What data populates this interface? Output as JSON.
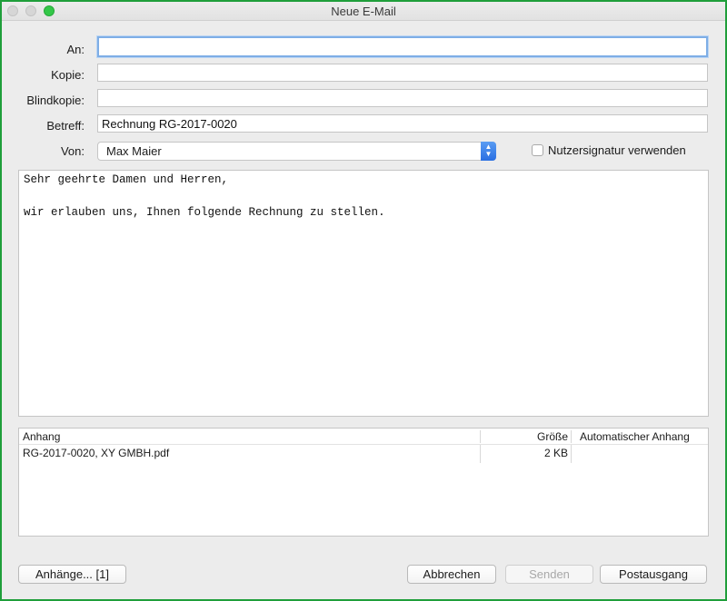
{
  "window": {
    "title": "Neue E-Mail"
  },
  "form": {
    "to_label": "An:",
    "to_value": "",
    "cc_label": "Kopie:",
    "cc_value": "",
    "bcc_label": "Blindkopie:",
    "bcc_value": "",
    "subject_label": "Betreff:",
    "subject_value": "Rechnung RG-2017-0020",
    "from_label": "Von:",
    "from_value": "Max Maier",
    "signature_label": "Nutzersignatur verwenden",
    "signature_checked": false
  },
  "message": {
    "lines": [
      "Sehr geehrte Damen und Herren,",
      "",
      "wir erlauben uns, Ihnen folgende Rechnung zu stellen."
    ]
  },
  "attachments": {
    "headers": {
      "name": "Anhang",
      "size": "Größe",
      "auto": "Automatischer Anhang"
    },
    "rows": [
      {
        "name": "RG-2017-0020, XY GMBH.pdf",
        "size": "2 KB",
        "auto": ""
      }
    ]
  },
  "buttons": {
    "attachments": "Anhänge... [1]",
    "cancel": "Abbrechen",
    "send": "Senden",
    "outbox": "Postausgang"
  },
  "colors": {
    "accent": "#2a6fe2",
    "focus_ring": "#7eaee6",
    "frame": "#1f9e3a"
  }
}
